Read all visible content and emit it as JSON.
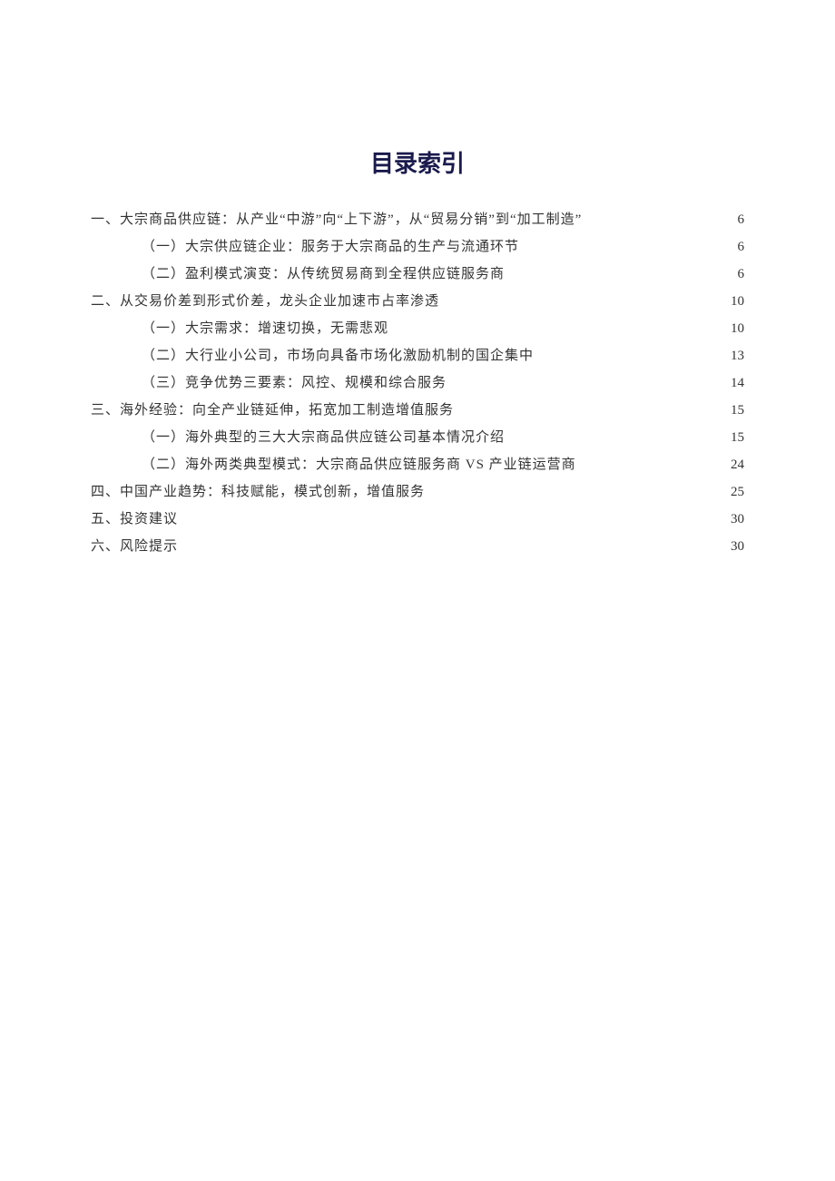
{
  "title": "目录索引",
  "toc": [
    {
      "level": 1,
      "label": "一、大宗商品供应链：从产业“中游”向“上下游”，从“贸易分销”到“加工制造”",
      "page": "6"
    },
    {
      "level": 2,
      "label": "（一）大宗供应链企业：服务于大宗商品的生产与流通环节",
      "page": "6"
    },
    {
      "level": 2,
      "label": "（二）盈利模式演变：从传统贸易商到全程供应链服务商",
      "page": "6"
    },
    {
      "level": 1,
      "label": "二、从交易价差到形式价差，龙头企业加速市占率渗透",
      "page": "10"
    },
    {
      "level": 2,
      "label": "（一）大宗需求：增速切换，无需悲观",
      "page": "10"
    },
    {
      "level": 2,
      "label": "（二）大行业小公司，市场向具备市场化激励机制的国企集中",
      "page": "13"
    },
    {
      "level": 2,
      "label": "（三）竞争优势三要素：风控、规模和综合服务",
      "page": "14"
    },
    {
      "level": 1,
      "label": "三、海外经验：向全产业链延伸，拓宽加工制造增值服务",
      "page": "15"
    },
    {
      "level": 2,
      "label": "（一）海外典型的三大大宗商品供应链公司基本情况介绍",
      "page": "15"
    },
    {
      "level": 2,
      "label": "（二）海外两类典型模式：大宗商品供应链服务商 VS 产业链运营商",
      "page": "24"
    },
    {
      "level": 1,
      "label": "四、中国产业趋势：科技赋能，模式创新，增值服务",
      "page": "25"
    },
    {
      "level": 1,
      "label": "五、投资建议",
      "page": "30"
    },
    {
      "level": 1,
      "label": "六、风险提示",
      "page": "30"
    }
  ]
}
